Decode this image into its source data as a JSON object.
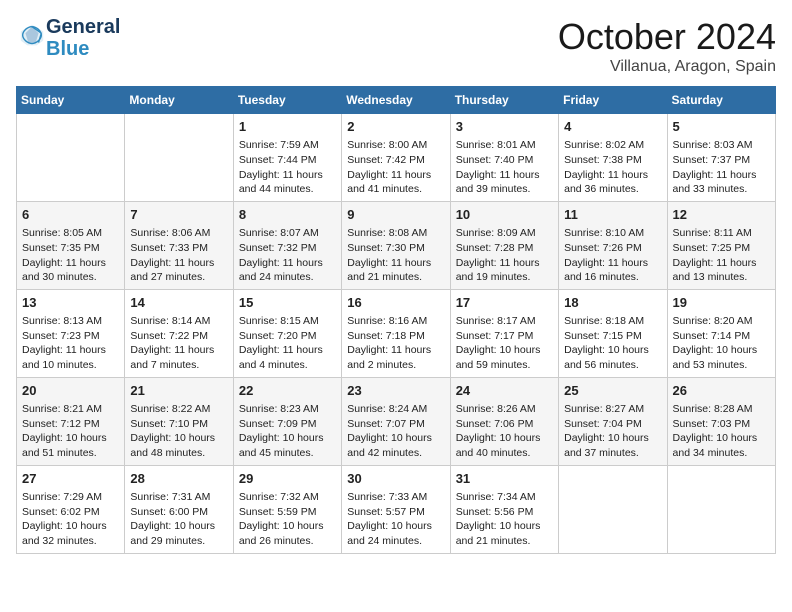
{
  "header": {
    "logo_line1": "General",
    "logo_line2": "Blue",
    "month": "October 2024",
    "location": "Villanua, Aragon, Spain"
  },
  "weekdays": [
    "Sunday",
    "Monday",
    "Tuesday",
    "Wednesday",
    "Thursday",
    "Friday",
    "Saturday"
  ],
  "weeks": [
    [
      {
        "day": "",
        "detail": ""
      },
      {
        "day": "",
        "detail": ""
      },
      {
        "day": "1",
        "detail": "Sunrise: 7:59 AM\nSunset: 7:44 PM\nDaylight: 11 hours\nand 44 minutes."
      },
      {
        "day": "2",
        "detail": "Sunrise: 8:00 AM\nSunset: 7:42 PM\nDaylight: 11 hours\nand 41 minutes."
      },
      {
        "day": "3",
        "detail": "Sunrise: 8:01 AM\nSunset: 7:40 PM\nDaylight: 11 hours\nand 39 minutes."
      },
      {
        "day": "4",
        "detail": "Sunrise: 8:02 AM\nSunset: 7:38 PM\nDaylight: 11 hours\nand 36 minutes."
      },
      {
        "day": "5",
        "detail": "Sunrise: 8:03 AM\nSunset: 7:37 PM\nDaylight: 11 hours\nand 33 minutes."
      }
    ],
    [
      {
        "day": "6",
        "detail": "Sunrise: 8:05 AM\nSunset: 7:35 PM\nDaylight: 11 hours\nand 30 minutes."
      },
      {
        "day": "7",
        "detail": "Sunrise: 8:06 AM\nSunset: 7:33 PM\nDaylight: 11 hours\nand 27 minutes."
      },
      {
        "day": "8",
        "detail": "Sunrise: 8:07 AM\nSunset: 7:32 PM\nDaylight: 11 hours\nand 24 minutes."
      },
      {
        "day": "9",
        "detail": "Sunrise: 8:08 AM\nSunset: 7:30 PM\nDaylight: 11 hours\nand 21 minutes."
      },
      {
        "day": "10",
        "detail": "Sunrise: 8:09 AM\nSunset: 7:28 PM\nDaylight: 11 hours\nand 19 minutes."
      },
      {
        "day": "11",
        "detail": "Sunrise: 8:10 AM\nSunset: 7:26 PM\nDaylight: 11 hours\nand 16 minutes."
      },
      {
        "day": "12",
        "detail": "Sunrise: 8:11 AM\nSunset: 7:25 PM\nDaylight: 11 hours\nand 13 minutes."
      }
    ],
    [
      {
        "day": "13",
        "detail": "Sunrise: 8:13 AM\nSunset: 7:23 PM\nDaylight: 11 hours\nand 10 minutes."
      },
      {
        "day": "14",
        "detail": "Sunrise: 8:14 AM\nSunset: 7:22 PM\nDaylight: 11 hours\nand 7 minutes."
      },
      {
        "day": "15",
        "detail": "Sunrise: 8:15 AM\nSunset: 7:20 PM\nDaylight: 11 hours\nand 4 minutes."
      },
      {
        "day": "16",
        "detail": "Sunrise: 8:16 AM\nSunset: 7:18 PM\nDaylight: 11 hours\nand 2 minutes."
      },
      {
        "day": "17",
        "detail": "Sunrise: 8:17 AM\nSunset: 7:17 PM\nDaylight: 10 hours\nand 59 minutes."
      },
      {
        "day": "18",
        "detail": "Sunrise: 8:18 AM\nSunset: 7:15 PM\nDaylight: 10 hours\nand 56 minutes."
      },
      {
        "day": "19",
        "detail": "Sunrise: 8:20 AM\nSunset: 7:14 PM\nDaylight: 10 hours\nand 53 minutes."
      }
    ],
    [
      {
        "day": "20",
        "detail": "Sunrise: 8:21 AM\nSunset: 7:12 PM\nDaylight: 10 hours\nand 51 minutes."
      },
      {
        "day": "21",
        "detail": "Sunrise: 8:22 AM\nSunset: 7:10 PM\nDaylight: 10 hours\nand 48 minutes."
      },
      {
        "day": "22",
        "detail": "Sunrise: 8:23 AM\nSunset: 7:09 PM\nDaylight: 10 hours\nand 45 minutes."
      },
      {
        "day": "23",
        "detail": "Sunrise: 8:24 AM\nSunset: 7:07 PM\nDaylight: 10 hours\nand 42 minutes."
      },
      {
        "day": "24",
        "detail": "Sunrise: 8:26 AM\nSunset: 7:06 PM\nDaylight: 10 hours\nand 40 minutes."
      },
      {
        "day": "25",
        "detail": "Sunrise: 8:27 AM\nSunset: 7:04 PM\nDaylight: 10 hours\nand 37 minutes."
      },
      {
        "day": "26",
        "detail": "Sunrise: 8:28 AM\nSunset: 7:03 PM\nDaylight: 10 hours\nand 34 minutes."
      }
    ],
    [
      {
        "day": "27",
        "detail": "Sunrise: 7:29 AM\nSunset: 6:02 PM\nDaylight: 10 hours\nand 32 minutes."
      },
      {
        "day": "28",
        "detail": "Sunrise: 7:31 AM\nSunset: 6:00 PM\nDaylight: 10 hours\nand 29 minutes."
      },
      {
        "day": "29",
        "detail": "Sunrise: 7:32 AM\nSunset: 5:59 PM\nDaylight: 10 hours\nand 26 minutes."
      },
      {
        "day": "30",
        "detail": "Sunrise: 7:33 AM\nSunset: 5:57 PM\nDaylight: 10 hours\nand 24 minutes."
      },
      {
        "day": "31",
        "detail": "Sunrise: 7:34 AM\nSunset: 5:56 PM\nDaylight: 10 hours\nand 21 minutes."
      },
      {
        "day": "",
        "detail": ""
      },
      {
        "day": "",
        "detail": ""
      }
    ]
  ]
}
